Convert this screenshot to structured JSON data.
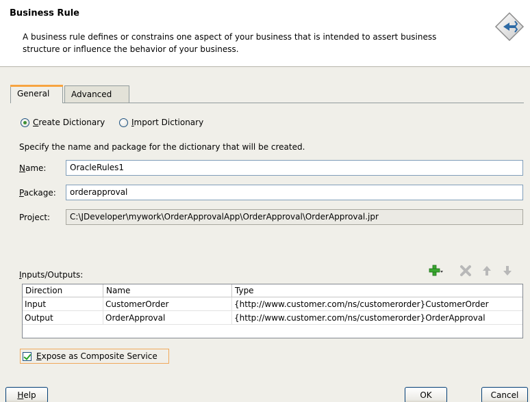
{
  "header": {
    "title": "Business Rule",
    "description": "A business rule defines or constrains one aspect of your business that is intended to assert business structure or influence the behavior of your business."
  },
  "tabs": [
    {
      "label": "General",
      "active": true
    },
    {
      "label": "Advanced",
      "active": false
    }
  ],
  "dictionary_mode": {
    "options": [
      {
        "label_mn": "C",
        "label_rest": "reate Dictionary",
        "selected": true
      },
      {
        "label_mn": "I",
        "label_rest": "mport Dictionary",
        "selected": false
      }
    ]
  },
  "spec_text": "Specify the name and package for the dictionary that will be created.",
  "fields": {
    "name": {
      "label_mn": "N",
      "label_rest": "ame:",
      "value": "OracleRules1"
    },
    "package": {
      "label_mn": "P",
      "label_rest": "ackage:",
      "value": "orderapproval"
    },
    "project": {
      "label": "Project:",
      "value": "C:\\JDeveloper\\mywork\\OrderApprovalApp\\OrderApproval\\OrderApproval.jpr"
    }
  },
  "io": {
    "label_mn": "I",
    "label_rest": "nputs/Outputs:",
    "toolbar": [
      "add-icon",
      "delete-icon",
      "move-up-icon",
      "move-down-icon"
    ],
    "columns": [
      "Direction",
      "Name",
      "Type"
    ],
    "rows": [
      [
        "Input",
        "CustomerOrder",
        "{http://www.customer.com/ns/customerorder}CustomerOrder"
      ],
      [
        "Output",
        "OrderApproval",
        "{http://www.customer.com/ns/customerorder}OrderApproval"
      ]
    ]
  },
  "expose": {
    "label_mn": "E",
    "label_rest": "xpose as Composite Service",
    "checked": true
  },
  "buttons": {
    "help_mn": "H",
    "help_rest": "elp",
    "ok": "OK",
    "cancel": "Cancel"
  },
  "colors": {
    "accent_tab": "#f7a440",
    "add_green": "#3aa830",
    "disabled_grey": "#b8b8b8"
  }
}
